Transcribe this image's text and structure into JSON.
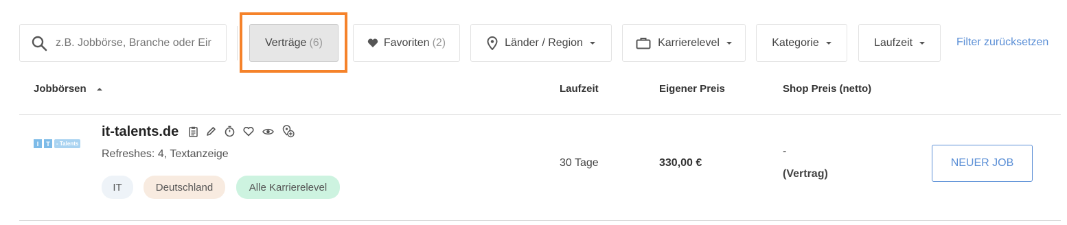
{
  "search": {
    "placeholder": "z.B. Jobbörse, Branche oder Eir"
  },
  "filters": {
    "contracts_label": "Verträge",
    "contracts_count": "(6)",
    "favorites_label": "Favoriten",
    "favorites_count": "(2)",
    "countries_label": "Länder / Region",
    "career_label": "Karrierelevel",
    "category_label": "Kategorie",
    "duration_label": "Laufzeit",
    "reset_label": "Filter zurücksetzen"
  },
  "table": {
    "headers": {
      "name": "Jobbörsen",
      "duration": "Laufzeit",
      "own_price": "Eigener Preis",
      "shop_price": "Shop Preis (netto)"
    },
    "rows": [
      {
        "name": "it-talents.de",
        "logo_text": [
          "I",
          "T",
          "- Talents"
        ],
        "details": "Refreshes: 4, Textanzeige",
        "tags": [
          "IT",
          "Deutschland",
          "Alle Karrierelevel"
        ],
        "duration": "30 Tage",
        "own_price": "330,00 €",
        "shop_price_dash": "-",
        "shop_price_note": "(Vertrag)",
        "action_label": "NEUER JOB",
        "icons": [
          "clipboard-icon",
          "pencil-icon",
          "stopwatch-icon",
          "heart-icon",
          "eye-icon",
          "location-add-icon"
        ]
      }
    ]
  },
  "colors": {
    "highlight": "#f5822a",
    "link": "#5b8fd6",
    "button_border": "#5b8fd6",
    "tag_it": "#eef3f8",
    "tag_country": "#f8ebe0",
    "tag_level": "#cdf3e0"
  }
}
